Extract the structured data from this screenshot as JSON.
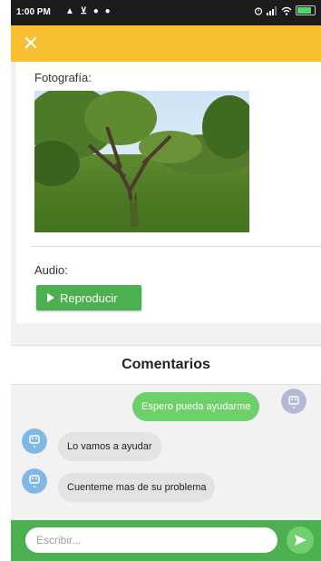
{
  "status_bar": {
    "time": "1:00 PM",
    "left_icons": "▲ ⊻ ● ●"
  },
  "toolbar": {
    "close_icon": "close-icon",
    "close_glyph": "✕",
    "background": "#f7c031"
  },
  "detail": {
    "photo_label": "Fotografía:",
    "audio_label": "Audio:",
    "play_button_label": "Reproducir"
  },
  "comments": {
    "title": "Comentarios",
    "messages": [
      {
        "side": "out",
        "text": "Espero pueda ayudarme"
      },
      {
        "side": "in",
        "text": "Lo vamos a ayudar"
      },
      {
        "side": "in",
        "text": "Cuenteme mas de su problema"
      }
    ]
  },
  "composer": {
    "placeholder": "Escribir...",
    "send_icon": "send-icon"
  },
  "colors": {
    "accent_yellow": "#f7c031",
    "accent_green": "#4caf50",
    "outgoing_bubble": "#6ed06a",
    "incoming_bubble": "#e3e3e3"
  }
}
